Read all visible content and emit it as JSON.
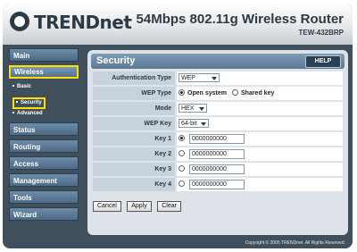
{
  "header": {
    "brand": "TRENDnet",
    "product_title": "54Mbps 802.11g Wireless Router",
    "model": "TEW-432BRP"
  },
  "sidebar": {
    "items": [
      {
        "label": "Main"
      },
      {
        "label": "Wireless",
        "active": true,
        "sub": [
          {
            "label": "Basic"
          },
          {
            "label": "Security",
            "active": true
          },
          {
            "label": "Advanced"
          }
        ]
      },
      {
        "label": "Status"
      },
      {
        "label": "Routing"
      },
      {
        "label": "Access"
      },
      {
        "label": "Management"
      },
      {
        "label": "Tools"
      },
      {
        "label": "Wizard"
      }
    ]
  },
  "section": {
    "title": "Security",
    "help_label": "HELP"
  },
  "form": {
    "auth": {
      "label": "Authentication Type",
      "value": "WEP"
    },
    "wep_type": {
      "label": "WEP Type",
      "opt1": "Open system",
      "opt2": "Shared key",
      "selected": "Open system"
    },
    "mode": {
      "label": "Mode",
      "value": "HEX"
    },
    "wep_key": {
      "label": "WEP Key",
      "value": "64-bit"
    },
    "keys": [
      {
        "label": "Key 1",
        "value": "0000000000",
        "selected": true
      },
      {
        "label": "Key 2",
        "value": "0000000000",
        "selected": false
      },
      {
        "label": "Key 3",
        "value": "0000000000",
        "selected": false
      },
      {
        "label": "Key 4",
        "value": "0000000000",
        "selected": false
      }
    ]
  },
  "buttons": {
    "cancel": "Cancel",
    "apply": "Apply",
    "clear": "Clear"
  },
  "footer": {
    "copyright": "Copyright © 2005 TRENDnet. All Rights Reserved."
  },
  "colors": {
    "frame": "#3f4f5c",
    "nav": "#5b7894",
    "highlight": "#ffe000",
    "panel": "#dde3e8"
  }
}
